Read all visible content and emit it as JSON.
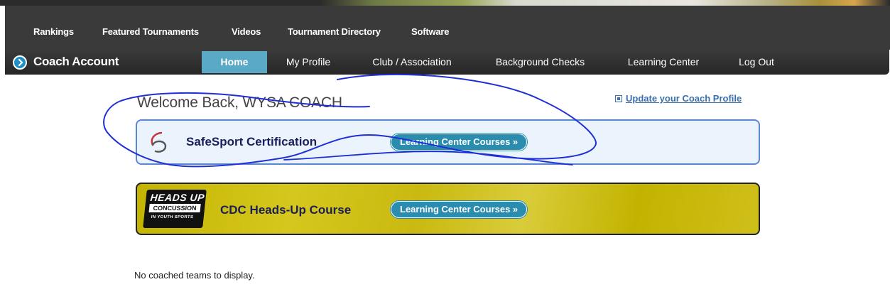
{
  "top_nav": {
    "items": [
      "Rankings",
      "Featured Tournaments",
      "Videos",
      "Tournament Directory",
      "Software"
    ]
  },
  "account_bar": {
    "title": "Coach Account",
    "tabs": [
      {
        "label": "Home",
        "active": true
      },
      {
        "label": "My Profile",
        "active": false
      },
      {
        "label": "Club / Association",
        "active": false
      },
      {
        "label": "Background Checks",
        "active": false
      },
      {
        "label": "Learning Center",
        "active": false
      },
      {
        "label": "Log Out",
        "active": false
      }
    ]
  },
  "main": {
    "welcome": "Welcome Back, WYSA COACH",
    "update_link": "Update your Coach Profile",
    "courses": [
      {
        "title": "SafeSport Certification",
        "button": "Learning Center Courses »"
      },
      {
        "title": "CDC Heads-Up Course",
        "button": "Learning Center Courses »",
        "logo": {
          "line1": "HEADS UP",
          "line2": "CONCUSSION",
          "line3": "IN YOUTH SPORTS"
        }
      }
    ],
    "no_teams": "No coached teams to display."
  },
  "colors": {
    "nav_bg": "#3a3a3a",
    "active_tab": "#5aa9c6",
    "pill": "#2a8db0",
    "link": "#3a6fb0",
    "safesport_border": "#5b86d6",
    "cdc_bg": "#c9b910",
    "annotation_ink": "#1f2fd6"
  }
}
